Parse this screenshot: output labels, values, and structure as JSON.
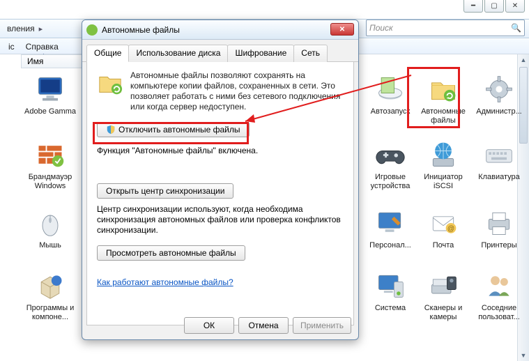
{
  "window": {
    "nav_fragment": "вления",
    "search_placeholder": "Поиск",
    "menu_help": "Справка",
    "menu_other": "іс",
    "column_header": "Имя"
  },
  "icons": {
    "adobe": "Adobe Gamma",
    "firewall": "Брандмауэр Windows",
    "mouse": "Мышь",
    "progs": "Программы и компоне...",
    "autorun": "Автозапуск",
    "offline": "Автономные файлы",
    "admin": "Администр...",
    "games": "Игровые устройства",
    "iscsi": "Инициатор iSCSI",
    "keyboard": "Клавиатура",
    "personal": "Персонал...",
    "mail": "Почта",
    "printers": "Принтеры",
    "system": "Система",
    "scanners": "Сканеры и камеры",
    "neighbors": "Соседние пользоват..."
  },
  "dialog": {
    "title": "Автономные файлы",
    "tabs": {
      "general": "Общие",
      "disk": "Использование диска",
      "encrypt": "Шифрование",
      "net": "Сеть"
    },
    "description": "Автономные файлы позволяют сохранять на компьютере копии файлов, сохраненных в сети.  Это позволяет работать с ними без сетевого подключения или когда сервер недоступен.",
    "disable_btn": "Отключить автономные файлы",
    "status": "Функция \"Автономные файлы\" включена.",
    "open_sync_btn": "Открыть центр синхронизации",
    "sync_desc": "Центр синхронизации используют, когда необходима синхронизация автономных файлов или проверка конфликтов синхронизации.",
    "view_offline_btn": "Просмотреть автономные файлы",
    "help_link": "Как работают автономные файлы?",
    "ok": "ОК",
    "cancel": "Отмена",
    "apply": "Применить"
  }
}
